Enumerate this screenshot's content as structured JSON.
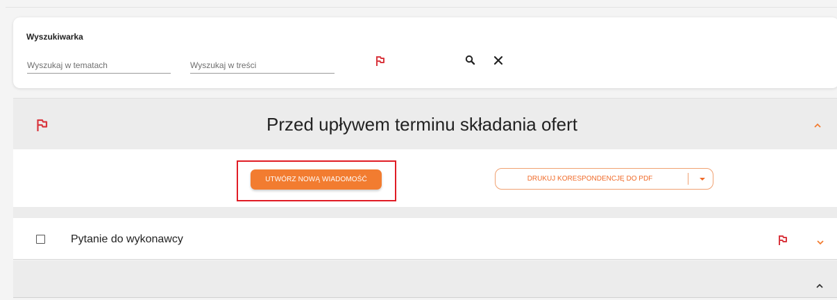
{
  "search": {
    "title": "Wyszukiwarka",
    "topics_placeholder": "Wyszukaj w tematach",
    "content_placeholder": "Wyszukaj w treści",
    "topics_value": "",
    "content_value": ""
  },
  "section": {
    "title": "Przed upływem terminu składania ofert"
  },
  "actions": {
    "new_message_label": "UTWÓRZ NOWĄ WIADOMOŚĆ",
    "print_pdf_label": "DRUKUJ KORESPONDENCJĘ DO PDF"
  },
  "message": {
    "title": "Pytanie do wykonawcy"
  },
  "colors": {
    "accent": "#f27c30",
    "flag": "#d9363e",
    "highlight": "#e01b24",
    "section_bg": "#ececec"
  },
  "icons": [
    "flag-icon",
    "search-icon",
    "close-icon",
    "chevron-up-icon",
    "chevron-down-icon",
    "caret-down-icon",
    "checkbox-icon"
  ]
}
